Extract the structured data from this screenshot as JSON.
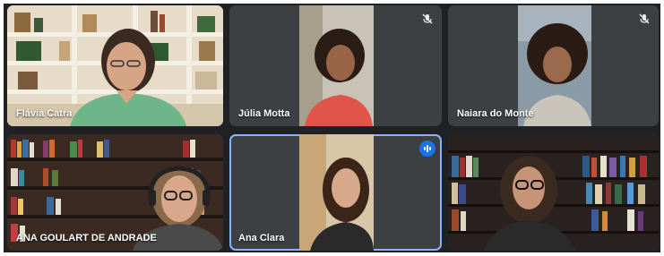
{
  "participants": [
    {
      "name": "Flávia Catra",
      "muted": false,
      "speaking": false
    },
    {
      "name": "Júlia Motta",
      "muted": true,
      "speaking": false
    },
    {
      "name": "Naiara do Monte",
      "muted": true,
      "speaking": false
    },
    {
      "name": "ANA GOULART DE ANDRADE",
      "muted": false,
      "speaking": false
    },
    {
      "name": "Ana Clara",
      "muted": false,
      "speaking": true
    },
    {
      "name": "",
      "muted": false,
      "speaking": false
    }
  ],
  "colors": {
    "stage": "#202124",
    "tile": "#3c4043",
    "active_border": "#8ab4f8",
    "speaking_badge": "#1a73e8"
  },
  "icons": {
    "muted": "mic-off-icon",
    "speaking": "audio-level-icon"
  }
}
